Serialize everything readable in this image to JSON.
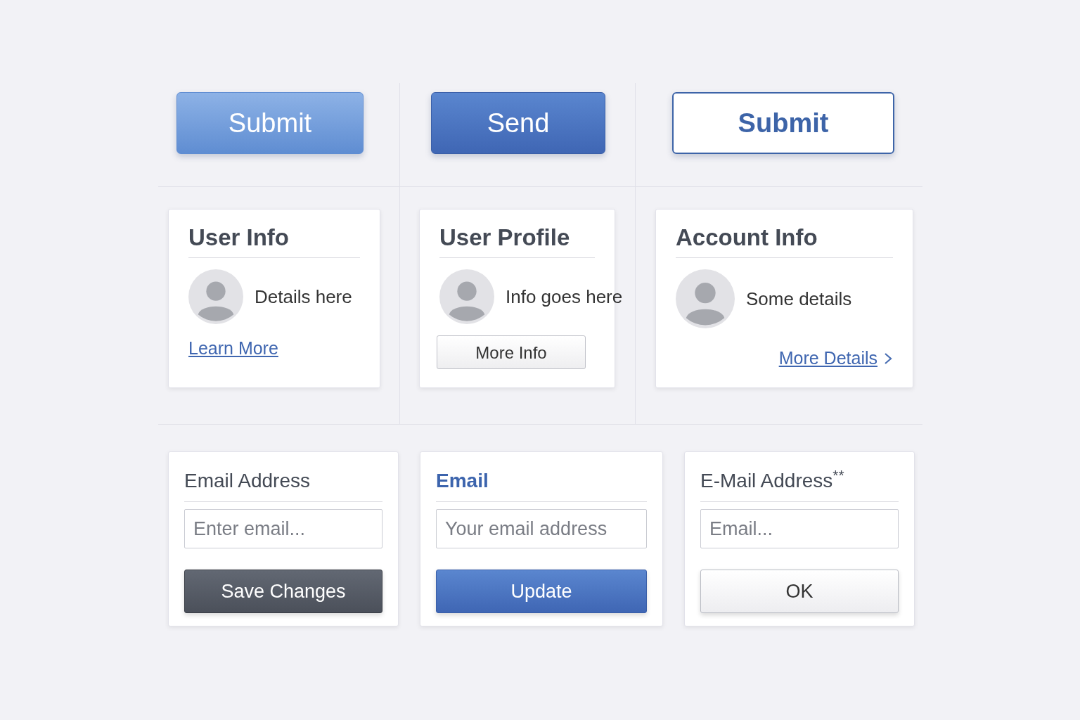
{
  "buttons": [
    {
      "label": "Submit",
      "kind": "light"
    },
    {
      "label": "Send",
      "kind": "primary"
    },
    {
      "label": "Submit",
      "kind": "outline"
    }
  ],
  "cards": [
    {
      "title": "User Info",
      "text": "Details here",
      "action": {
        "kind": "link",
        "label": "Learn More"
      }
    },
    {
      "title": "User Profile",
      "text": "Info goes here",
      "action": {
        "kind": "button",
        "label": "More Info"
      }
    },
    {
      "title": "Account Info",
      "text": "Some details",
      "action": {
        "kind": "arrow_link",
        "label": "More Details"
      }
    }
  ],
  "forms": [
    {
      "label": "Email Address",
      "accent": false,
      "placeholder": "Enter email...",
      "button": {
        "label": "Save Changes",
        "kind": "dark"
      }
    },
    {
      "label": "Email",
      "accent": true,
      "placeholder": "Your email address",
      "button": {
        "label": "Update",
        "kind": "primary"
      }
    },
    {
      "label": "E-Mail Address$^{**}$",
      "accent": false,
      "placeholder": "Email...",
      "button": {
        "label": "OK",
        "kind": "plain"
      }
    }
  ]
}
